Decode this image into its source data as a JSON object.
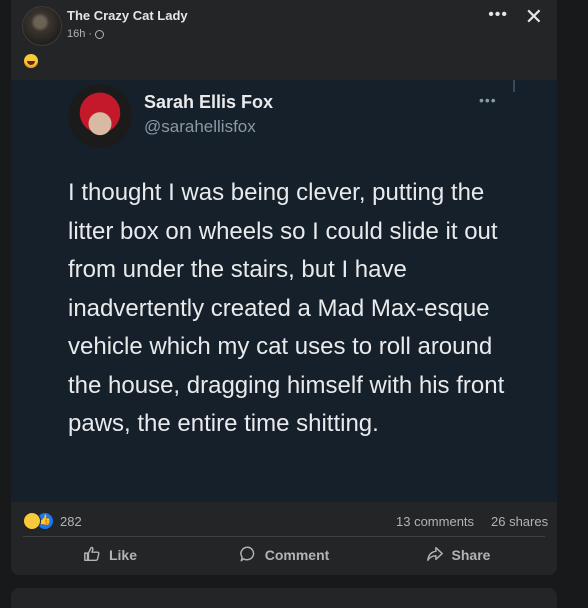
{
  "post": {
    "page_name": "The Crazy Cat Lady",
    "time": "16h",
    "more_label": "•••",
    "close_label": "✕"
  },
  "tweet": {
    "name": "Sarah Ellis Fox",
    "handle": "@sarahellisfox",
    "more_label": "•••",
    "text": "I thought I was being clever, putting the litter box on wheels so I could slide it out from under the stairs, but I have inadvertently created a Mad Max-esque vehicle which my cat uses to roll around the house, dragging himself with his front paws, the entire time shitting."
  },
  "stats": {
    "reaction_count": "282",
    "comments": "13 comments",
    "shares": "26 shares"
  },
  "actions": {
    "like": "Like",
    "comment": "Comment",
    "share": "Share"
  },
  "colors": {
    "card_bg": "#242526",
    "tweet_bg": "#15202b",
    "like_blue": "#1877f2"
  }
}
